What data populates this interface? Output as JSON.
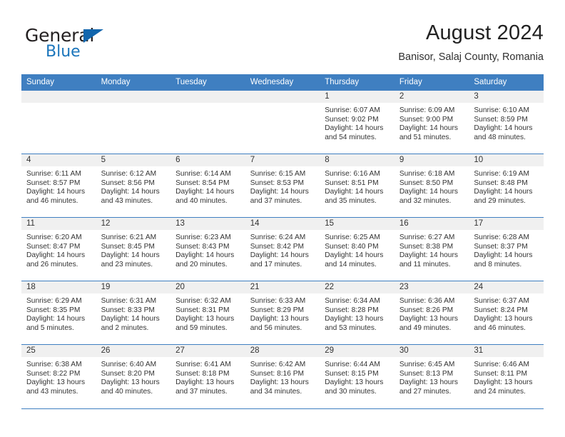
{
  "brand": {
    "name_top": "General",
    "name_bottom": "Blue",
    "flag_icon": "triangle-flag-icon",
    "accent_color": "#1b75bb"
  },
  "header": {
    "title": "August 2024",
    "subtitle": "Banisor, Salaj County, Romania"
  },
  "calendar": {
    "header_bg": "#3f7fc1",
    "daynum_bg": "#f0f0f0",
    "weekday_headers": [
      "Sunday",
      "Monday",
      "Tuesday",
      "Wednesday",
      "Thursday",
      "Friday",
      "Saturday"
    ],
    "weeks": [
      [
        {
          "day": "",
          "lines": []
        },
        {
          "day": "",
          "lines": []
        },
        {
          "day": "",
          "lines": []
        },
        {
          "day": "",
          "lines": []
        },
        {
          "day": "1",
          "lines": [
            "Sunrise: 6:07 AM",
            "Sunset: 9:02 PM",
            "Daylight: 14 hours",
            "and 54 minutes."
          ]
        },
        {
          "day": "2",
          "lines": [
            "Sunrise: 6:09 AM",
            "Sunset: 9:00 PM",
            "Daylight: 14 hours",
            "and 51 minutes."
          ]
        },
        {
          "day": "3",
          "lines": [
            "Sunrise: 6:10 AM",
            "Sunset: 8:59 PM",
            "Daylight: 14 hours",
            "and 48 minutes."
          ]
        }
      ],
      [
        {
          "day": "4",
          "lines": [
            "Sunrise: 6:11 AM",
            "Sunset: 8:57 PM",
            "Daylight: 14 hours",
            "and 46 minutes."
          ]
        },
        {
          "day": "5",
          "lines": [
            "Sunrise: 6:12 AM",
            "Sunset: 8:56 PM",
            "Daylight: 14 hours",
            "and 43 minutes."
          ]
        },
        {
          "day": "6",
          "lines": [
            "Sunrise: 6:14 AM",
            "Sunset: 8:54 PM",
            "Daylight: 14 hours",
            "and 40 minutes."
          ]
        },
        {
          "day": "7",
          "lines": [
            "Sunrise: 6:15 AM",
            "Sunset: 8:53 PM",
            "Daylight: 14 hours",
            "and 37 minutes."
          ]
        },
        {
          "day": "8",
          "lines": [
            "Sunrise: 6:16 AM",
            "Sunset: 8:51 PM",
            "Daylight: 14 hours",
            "and 35 minutes."
          ]
        },
        {
          "day": "9",
          "lines": [
            "Sunrise: 6:18 AM",
            "Sunset: 8:50 PM",
            "Daylight: 14 hours",
            "and 32 minutes."
          ]
        },
        {
          "day": "10",
          "lines": [
            "Sunrise: 6:19 AM",
            "Sunset: 8:48 PM",
            "Daylight: 14 hours",
            "and 29 minutes."
          ]
        }
      ],
      [
        {
          "day": "11",
          "lines": [
            "Sunrise: 6:20 AM",
            "Sunset: 8:47 PM",
            "Daylight: 14 hours",
            "and 26 minutes."
          ]
        },
        {
          "day": "12",
          "lines": [
            "Sunrise: 6:21 AM",
            "Sunset: 8:45 PM",
            "Daylight: 14 hours",
            "and 23 minutes."
          ]
        },
        {
          "day": "13",
          "lines": [
            "Sunrise: 6:23 AM",
            "Sunset: 8:43 PM",
            "Daylight: 14 hours",
            "and 20 minutes."
          ]
        },
        {
          "day": "14",
          "lines": [
            "Sunrise: 6:24 AM",
            "Sunset: 8:42 PM",
            "Daylight: 14 hours",
            "and 17 minutes."
          ]
        },
        {
          "day": "15",
          "lines": [
            "Sunrise: 6:25 AM",
            "Sunset: 8:40 PM",
            "Daylight: 14 hours",
            "and 14 minutes."
          ]
        },
        {
          "day": "16",
          "lines": [
            "Sunrise: 6:27 AM",
            "Sunset: 8:38 PM",
            "Daylight: 14 hours",
            "and 11 minutes."
          ]
        },
        {
          "day": "17",
          "lines": [
            "Sunrise: 6:28 AM",
            "Sunset: 8:37 PM",
            "Daylight: 14 hours",
            "and 8 minutes."
          ]
        }
      ],
      [
        {
          "day": "18",
          "lines": [
            "Sunrise: 6:29 AM",
            "Sunset: 8:35 PM",
            "Daylight: 14 hours",
            "and 5 minutes."
          ]
        },
        {
          "day": "19",
          "lines": [
            "Sunrise: 6:31 AM",
            "Sunset: 8:33 PM",
            "Daylight: 14 hours",
            "and 2 minutes."
          ]
        },
        {
          "day": "20",
          "lines": [
            "Sunrise: 6:32 AM",
            "Sunset: 8:31 PM",
            "Daylight: 13 hours",
            "and 59 minutes."
          ]
        },
        {
          "day": "21",
          "lines": [
            "Sunrise: 6:33 AM",
            "Sunset: 8:29 PM",
            "Daylight: 13 hours",
            "and 56 minutes."
          ]
        },
        {
          "day": "22",
          "lines": [
            "Sunrise: 6:34 AM",
            "Sunset: 8:28 PM",
            "Daylight: 13 hours",
            "and 53 minutes."
          ]
        },
        {
          "day": "23",
          "lines": [
            "Sunrise: 6:36 AM",
            "Sunset: 8:26 PM",
            "Daylight: 13 hours",
            "and 49 minutes."
          ]
        },
        {
          "day": "24",
          "lines": [
            "Sunrise: 6:37 AM",
            "Sunset: 8:24 PM",
            "Daylight: 13 hours",
            "and 46 minutes."
          ]
        }
      ],
      [
        {
          "day": "25",
          "lines": [
            "Sunrise: 6:38 AM",
            "Sunset: 8:22 PM",
            "Daylight: 13 hours",
            "and 43 minutes."
          ]
        },
        {
          "day": "26",
          "lines": [
            "Sunrise: 6:40 AM",
            "Sunset: 8:20 PM",
            "Daylight: 13 hours",
            "and 40 minutes."
          ]
        },
        {
          "day": "27",
          "lines": [
            "Sunrise: 6:41 AM",
            "Sunset: 8:18 PM",
            "Daylight: 13 hours",
            "and 37 minutes."
          ]
        },
        {
          "day": "28",
          "lines": [
            "Sunrise: 6:42 AM",
            "Sunset: 8:16 PM",
            "Daylight: 13 hours",
            "and 34 minutes."
          ]
        },
        {
          "day": "29",
          "lines": [
            "Sunrise: 6:44 AM",
            "Sunset: 8:15 PM",
            "Daylight: 13 hours",
            "and 30 minutes."
          ]
        },
        {
          "day": "30",
          "lines": [
            "Sunrise: 6:45 AM",
            "Sunset: 8:13 PM",
            "Daylight: 13 hours",
            "and 27 minutes."
          ]
        },
        {
          "day": "31",
          "lines": [
            "Sunrise: 6:46 AM",
            "Sunset: 8:11 PM",
            "Daylight: 13 hours",
            "and 24 minutes."
          ]
        }
      ]
    ]
  }
}
